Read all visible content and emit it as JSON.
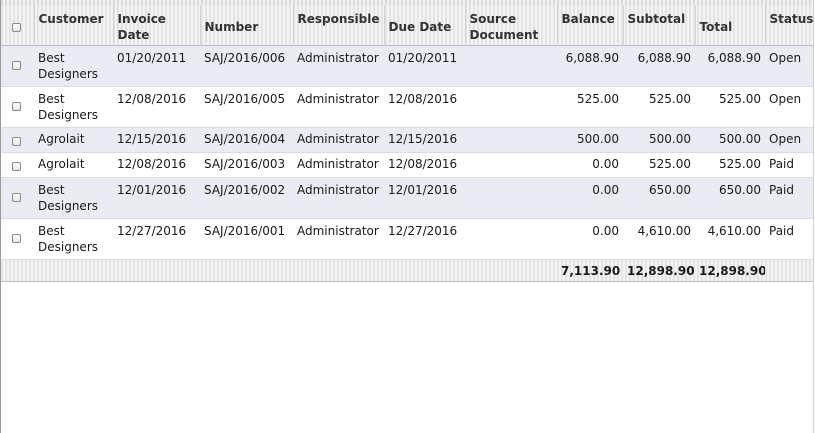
{
  "header": {
    "select_all": "",
    "customer": "Customer",
    "invoice_date": "Invoice Date",
    "number": "Number",
    "responsible": "Responsible",
    "due_date": "Due Date",
    "source_document": "Source Document",
    "balance": "Balance",
    "subtotal": "Subtotal",
    "total": "Total",
    "status": "Status"
  },
  "rows": [
    {
      "customer": "Best Designers",
      "invoice_date": "01/20/2011",
      "number": "SAJ/2016/006",
      "responsible": "Administrator",
      "due_date": "01/20/2011",
      "source_document": "",
      "balance": "6,088.90",
      "subtotal": "6,088.90",
      "total": "6,088.90",
      "status": "Open"
    },
    {
      "customer": "Best Designers",
      "invoice_date": "12/08/2016",
      "number": "SAJ/2016/005",
      "responsible": "Administrator",
      "due_date": "12/08/2016",
      "source_document": "",
      "balance": "525.00",
      "subtotal": "525.00",
      "total": "525.00",
      "status": "Open"
    },
    {
      "customer": "Agrolait",
      "invoice_date": "12/15/2016",
      "number": "SAJ/2016/004",
      "responsible": "Administrator",
      "due_date": "12/15/2016",
      "source_document": "",
      "balance": "500.00",
      "subtotal": "500.00",
      "total": "500.00",
      "status": "Open"
    },
    {
      "customer": "Agrolait",
      "invoice_date": "12/08/2016",
      "number": "SAJ/2016/003",
      "responsible": "Administrator",
      "due_date": "12/08/2016",
      "source_document": "",
      "balance": "0.00",
      "subtotal": "525.00",
      "total": "525.00",
      "status": "Paid"
    },
    {
      "customer": "Best Designers",
      "invoice_date": "12/01/2016",
      "number": "SAJ/2016/002",
      "responsible": "Administrator",
      "due_date": "12/01/2016",
      "source_document": "",
      "balance": "0.00",
      "subtotal": "650.00",
      "total": "650.00",
      "status": "Paid"
    },
    {
      "customer": "Best Designers",
      "invoice_date": "12/27/2016",
      "number": "SAJ/2016/001",
      "responsible": "Administrator",
      "due_date": "12/27/2016",
      "source_document": "",
      "balance": "0.00",
      "subtotal": "4,610.00",
      "total": "4,610.00",
      "status": "Paid"
    }
  ],
  "totals": {
    "balance": "7,113.90",
    "subtotal": "12,898.90",
    "total": "12,898.90"
  }
}
